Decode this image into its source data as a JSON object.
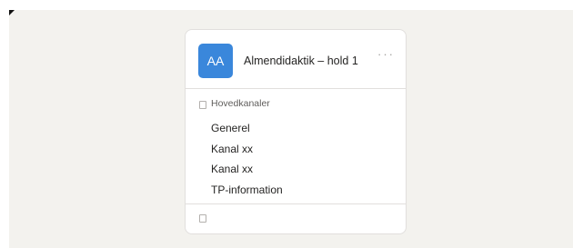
{
  "team": {
    "avatar_initials": "AA",
    "avatar_color": "#3a87db",
    "name": "Almendidaktik – hold 1",
    "more_icon": "ellipsis-icon"
  },
  "section": {
    "title": "Hovedkanaler",
    "icon": "box-icon"
  },
  "channels": [
    {
      "label": "Generel"
    },
    {
      "label": "Kanal xx"
    },
    {
      "label": "Kanal xx"
    },
    {
      "label": "TP-information"
    }
  ],
  "footer": {
    "icon": "box-icon"
  }
}
